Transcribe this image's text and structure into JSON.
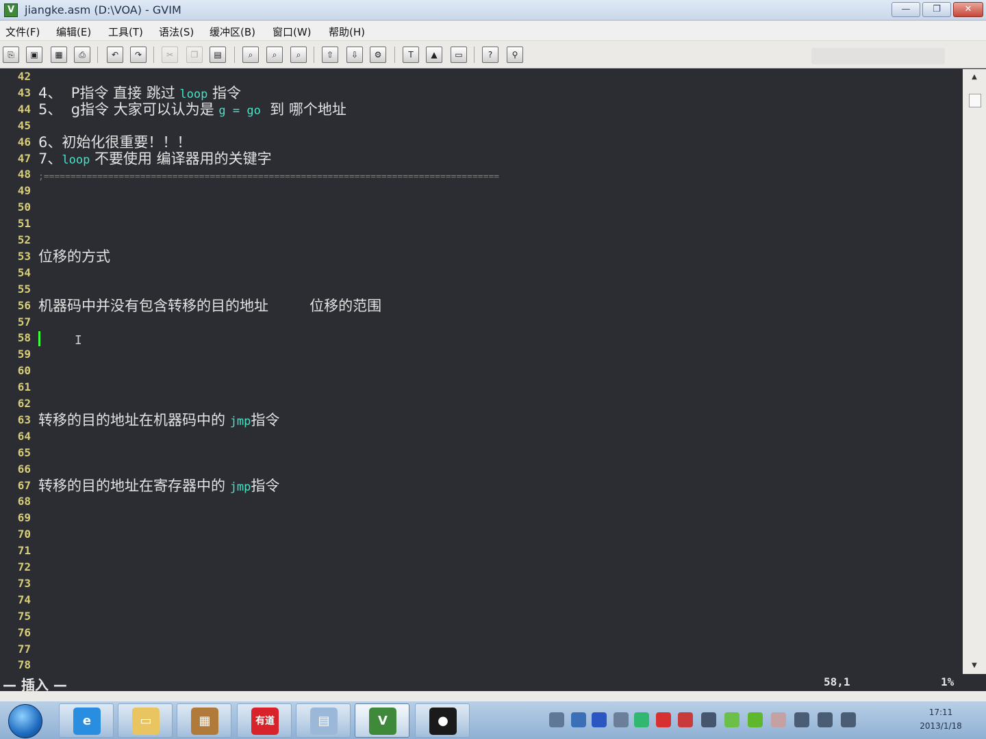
{
  "window": {
    "title": "jiangke.asm (D:\\VOA) - GVIM"
  },
  "menu": {
    "items": [
      "文件(F)",
      "编辑(E)",
      "工具(T)",
      "语法(S)",
      "缓冲区(B)",
      "窗口(W)",
      "帮助(H)"
    ]
  },
  "toolbar": {
    "buttons": [
      {
        "icon": "open-icon",
        "glyph": "⎘"
      },
      {
        "icon": "save-icon",
        "glyph": "▣"
      },
      {
        "icon": "save-all-icon",
        "glyph": "▦"
      },
      {
        "icon": "print-icon",
        "glyph": "⎙"
      },
      {
        "icon": "undo-icon",
        "glyph": "↶"
      },
      {
        "icon": "redo-icon",
        "glyph": "↷"
      },
      {
        "icon": "cut-icon",
        "glyph": "✂"
      },
      {
        "icon": "copy-icon",
        "glyph": "❐"
      },
      {
        "icon": "paste-icon",
        "glyph": "▤"
      },
      {
        "icon": "find-replace-icon",
        "glyph": "⌕"
      },
      {
        "icon": "find-next-icon",
        "glyph": "⌕"
      },
      {
        "icon": "find-prev-icon",
        "glyph": "⌕"
      },
      {
        "icon": "load-session-icon",
        "glyph": "⇧"
      },
      {
        "icon": "save-session-icon",
        "glyph": "⇩"
      },
      {
        "icon": "run-script-icon",
        "glyph": "⚙"
      },
      {
        "icon": "make-icon",
        "glyph": "T"
      },
      {
        "icon": "build-tags-icon",
        "glyph": "▲"
      },
      {
        "icon": "jump-tag-icon",
        "glyph": "▭"
      },
      {
        "icon": "help-icon",
        "glyph": "?"
      },
      {
        "icon": "find-help-icon",
        "glyph": "⚲"
      }
    ]
  },
  "editor": {
    "lines": [
      {
        "num": "42",
        "text": ""
      },
      {
        "num": "43",
        "text": "4、  P指令 直接 跳过 ",
        "kw": "loop",
        "tail": " 指令"
      },
      {
        "num": "44",
        "text": "5、  g指令 大家可以认为是 ",
        "kw": "g = go",
        "tail": "  到 哪个地址"
      },
      {
        "num": "45",
        "text": ""
      },
      {
        "num": "46",
        "text": "6、初始化很重要！！！"
      },
      {
        "num": "47",
        "text": "7、",
        "kw": "loop",
        "tail": " 不要使用 编译器用的关键字"
      },
      {
        "num": "48",
        "text": "",
        "dash": ";====================================================================================="
      },
      {
        "num": "49",
        "text": ""
      },
      {
        "num": "50",
        "text": ""
      },
      {
        "num": "51",
        "text": ""
      },
      {
        "num": "52",
        "text": ""
      },
      {
        "num": "53",
        "text": "位移的方式"
      },
      {
        "num": "54",
        "text": ""
      },
      {
        "num": "55",
        "text": ""
      },
      {
        "num": "56",
        "text": "机器码中并没有包含转移的目的地址         位移的范围"
      },
      {
        "num": "57",
        "text": ""
      },
      {
        "num": "58",
        "text": "",
        "cursor": true
      },
      {
        "num": "59",
        "text": ""
      },
      {
        "num": "60",
        "text": ""
      },
      {
        "num": "61",
        "text": ""
      },
      {
        "num": "62",
        "text": ""
      },
      {
        "num": "63",
        "text": "转移的目的地址在机器码中的 ",
        "kw": "jmp",
        "tail": "指令"
      },
      {
        "num": "64",
        "text": ""
      },
      {
        "num": "65",
        "text": ""
      },
      {
        "num": "66",
        "text": ""
      },
      {
        "num": "67",
        "text": "转移的目的地址在寄存器中的 ",
        "kw": "jmp",
        "tail": "指令"
      },
      {
        "num": "68",
        "text": ""
      },
      {
        "num": "69",
        "text": ""
      },
      {
        "num": "70",
        "text": ""
      },
      {
        "num": "71",
        "text": ""
      },
      {
        "num": "72",
        "text": ""
      },
      {
        "num": "73",
        "text": ""
      },
      {
        "num": "74",
        "text": ""
      },
      {
        "num": "75",
        "text": ""
      },
      {
        "num": "76",
        "text": ""
      },
      {
        "num": "77",
        "text": ""
      },
      {
        "num": "78",
        "text": ""
      }
    ]
  },
  "statusline": {
    "mode": "— 插入 —",
    "position": "58,1",
    "percent": "1%"
  },
  "colors": {
    "background": "#2b2d33",
    "line_number": "#d8cf78",
    "keyword": "#4fe0c6",
    "cursor": "#3cff3c"
  },
  "taskbar": {
    "apps": [
      {
        "name": "internet-explorer-icon",
        "glyph": "e",
        "color": "#2a8ee0"
      },
      {
        "name": "file-explorer-icon",
        "glyph": "▭",
        "color": "#e8c560"
      },
      {
        "name": "book-app-icon",
        "glyph": "▦",
        "color": "#b07a3a"
      },
      {
        "name": "youdao-dict-icon",
        "glyph": "有道",
        "color": "#d8232a"
      },
      {
        "name": "document-app-icon",
        "glyph": "▤",
        "color": "#9cb8d8"
      },
      {
        "name": "gvim-icon",
        "glyph": "V",
        "color": "#3f8a3a"
      },
      {
        "name": "obs-icon",
        "glyph": "●",
        "color": "#1a1a1a"
      }
    ],
    "tray_colors": [
      "#5f7896",
      "#3b6fb8",
      "#2c57c2",
      "#6b7f9a",
      "#30b870",
      "#d63030",
      "#c93a3a",
      "#44556d",
      "#6cc04a",
      "#5fb82c",
      "#c5a1a1",
      "#4b5d75",
      "#4b5d75",
      "#4b5d75"
    ],
    "clock_time": "17:11",
    "clock_date": "2013/1/18"
  }
}
